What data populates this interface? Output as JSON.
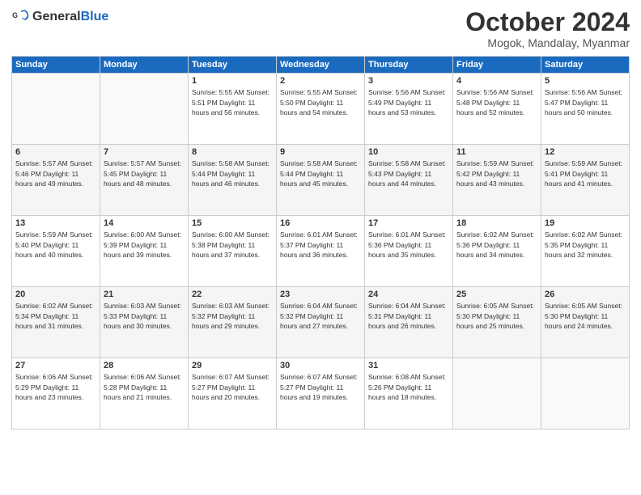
{
  "header": {
    "logo_general": "General",
    "logo_blue": "Blue",
    "month": "October 2024",
    "location": "Mogok, Mandalay, Myanmar"
  },
  "days_of_week": [
    "Sunday",
    "Monday",
    "Tuesday",
    "Wednesday",
    "Thursday",
    "Friday",
    "Saturday"
  ],
  "weeks": [
    [
      {
        "day": "",
        "info": ""
      },
      {
        "day": "",
        "info": ""
      },
      {
        "day": "1",
        "info": "Sunrise: 5:55 AM\nSunset: 5:51 PM\nDaylight: 11 hours\nand 56 minutes."
      },
      {
        "day": "2",
        "info": "Sunrise: 5:55 AM\nSunset: 5:50 PM\nDaylight: 11 hours\nand 54 minutes."
      },
      {
        "day": "3",
        "info": "Sunrise: 5:56 AM\nSunset: 5:49 PM\nDaylight: 11 hours\nand 53 minutes."
      },
      {
        "day": "4",
        "info": "Sunrise: 5:56 AM\nSunset: 5:48 PM\nDaylight: 11 hours\nand 52 minutes."
      },
      {
        "day": "5",
        "info": "Sunrise: 5:56 AM\nSunset: 5:47 PM\nDaylight: 11 hours\nand 50 minutes."
      }
    ],
    [
      {
        "day": "6",
        "info": "Sunrise: 5:57 AM\nSunset: 5:46 PM\nDaylight: 11 hours\nand 49 minutes."
      },
      {
        "day": "7",
        "info": "Sunrise: 5:57 AM\nSunset: 5:45 PM\nDaylight: 11 hours\nand 48 minutes."
      },
      {
        "day": "8",
        "info": "Sunrise: 5:58 AM\nSunset: 5:44 PM\nDaylight: 11 hours\nand 46 minutes."
      },
      {
        "day": "9",
        "info": "Sunrise: 5:58 AM\nSunset: 5:44 PM\nDaylight: 11 hours\nand 45 minutes."
      },
      {
        "day": "10",
        "info": "Sunrise: 5:58 AM\nSunset: 5:43 PM\nDaylight: 11 hours\nand 44 minutes."
      },
      {
        "day": "11",
        "info": "Sunrise: 5:59 AM\nSunset: 5:42 PM\nDaylight: 11 hours\nand 43 minutes."
      },
      {
        "day": "12",
        "info": "Sunrise: 5:59 AM\nSunset: 5:41 PM\nDaylight: 11 hours\nand 41 minutes."
      }
    ],
    [
      {
        "day": "13",
        "info": "Sunrise: 5:59 AM\nSunset: 5:40 PM\nDaylight: 11 hours\nand 40 minutes."
      },
      {
        "day": "14",
        "info": "Sunrise: 6:00 AM\nSunset: 5:39 PM\nDaylight: 11 hours\nand 39 minutes."
      },
      {
        "day": "15",
        "info": "Sunrise: 6:00 AM\nSunset: 5:38 PM\nDaylight: 11 hours\nand 37 minutes."
      },
      {
        "day": "16",
        "info": "Sunrise: 6:01 AM\nSunset: 5:37 PM\nDaylight: 11 hours\nand 36 minutes."
      },
      {
        "day": "17",
        "info": "Sunrise: 6:01 AM\nSunset: 5:36 PM\nDaylight: 11 hours\nand 35 minutes."
      },
      {
        "day": "18",
        "info": "Sunrise: 6:02 AM\nSunset: 5:36 PM\nDaylight: 11 hours\nand 34 minutes."
      },
      {
        "day": "19",
        "info": "Sunrise: 6:02 AM\nSunset: 5:35 PM\nDaylight: 11 hours\nand 32 minutes."
      }
    ],
    [
      {
        "day": "20",
        "info": "Sunrise: 6:02 AM\nSunset: 5:34 PM\nDaylight: 11 hours\nand 31 minutes."
      },
      {
        "day": "21",
        "info": "Sunrise: 6:03 AM\nSunset: 5:33 PM\nDaylight: 11 hours\nand 30 minutes."
      },
      {
        "day": "22",
        "info": "Sunrise: 6:03 AM\nSunset: 5:32 PM\nDaylight: 11 hours\nand 29 minutes."
      },
      {
        "day": "23",
        "info": "Sunrise: 6:04 AM\nSunset: 5:32 PM\nDaylight: 11 hours\nand 27 minutes."
      },
      {
        "day": "24",
        "info": "Sunrise: 6:04 AM\nSunset: 5:31 PM\nDaylight: 11 hours\nand 26 minutes."
      },
      {
        "day": "25",
        "info": "Sunrise: 6:05 AM\nSunset: 5:30 PM\nDaylight: 11 hours\nand 25 minutes."
      },
      {
        "day": "26",
        "info": "Sunrise: 6:05 AM\nSunset: 5:30 PM\nDaylight: 11 hours\nand 24 minutes."
      }
    ],
    [
      {
        "day": "27",
        "info": "Sunrise: 6:06 AM\nSunset: 5:29 PM\nDaylight: 11 hours\nand 23 minutes."
      },
      {
        "day": "28",
        "info": "Sunrise: 6:06 AM\nSunset: 5:28 PM\nDaylight: 11 hours\nand 21 minutes."
      },
      {
        "day": "29",
        "info": "Sunrise: 6:07 AM\nSunset: 5:27 PM\nDaylight: 11 hours\nand 20 minutes."
      },
      {
        "day": "30",
        "info": "Sunrise: 6:07 AM\nSunset: 5:27 PM\nDaylight: 11 hours\nand 19 minutes."
      },
      {
        "day": "31",
        "info": "Sunrise: 6:08 AM\nSunset: 5:26 PM\nDaylight: 11 hours\nand 18 minutes."
      },
      {
        "day": "",
        "info": ""
      },
      {
        "day": "",
        "info": ""
      }
    ]
  ]
}
